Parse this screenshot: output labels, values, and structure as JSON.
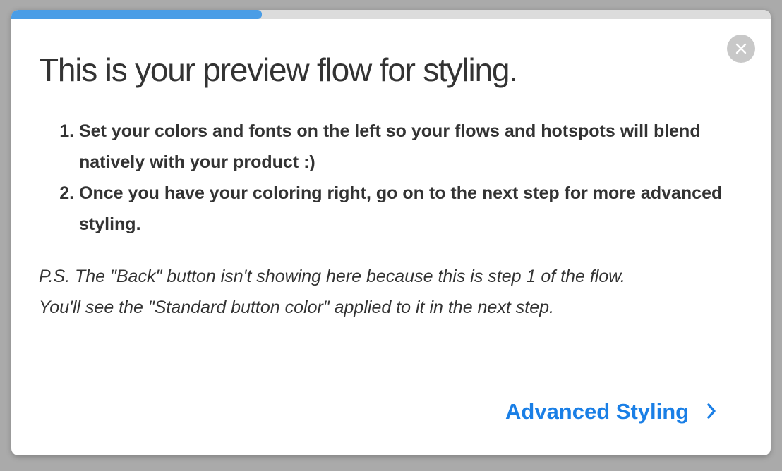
{
  "progress": {
    "fraction": 0.33
  },
  "dialog": {
    "title": "This is your preview flow for styling.",
    "steps": [
      "Set your colors and fonts on the left so your flows and hotspots will blend natively with your product :)",
      "Once you have your coloring right, go on to the next step for more advanced styling."
    ],
    "ps_line1": "P.S. The \"Back\" button isn't showing here because this is step 1 of the flow.",
    "ps_line2": "You'll see the \"Standard button color\" applied to it in the next step.",
    "next_label": "Advanced Styling"
  },
  "icons": {
    "close": "close-icon",
    "next": "chevron-right-icon"
  },
  "colors": {
    "accent": "#1a7fe6",
    "progress": "#4a9de6",
    "text": "#333333",
    "close_bg": "#c8c8c8"
  }
}
